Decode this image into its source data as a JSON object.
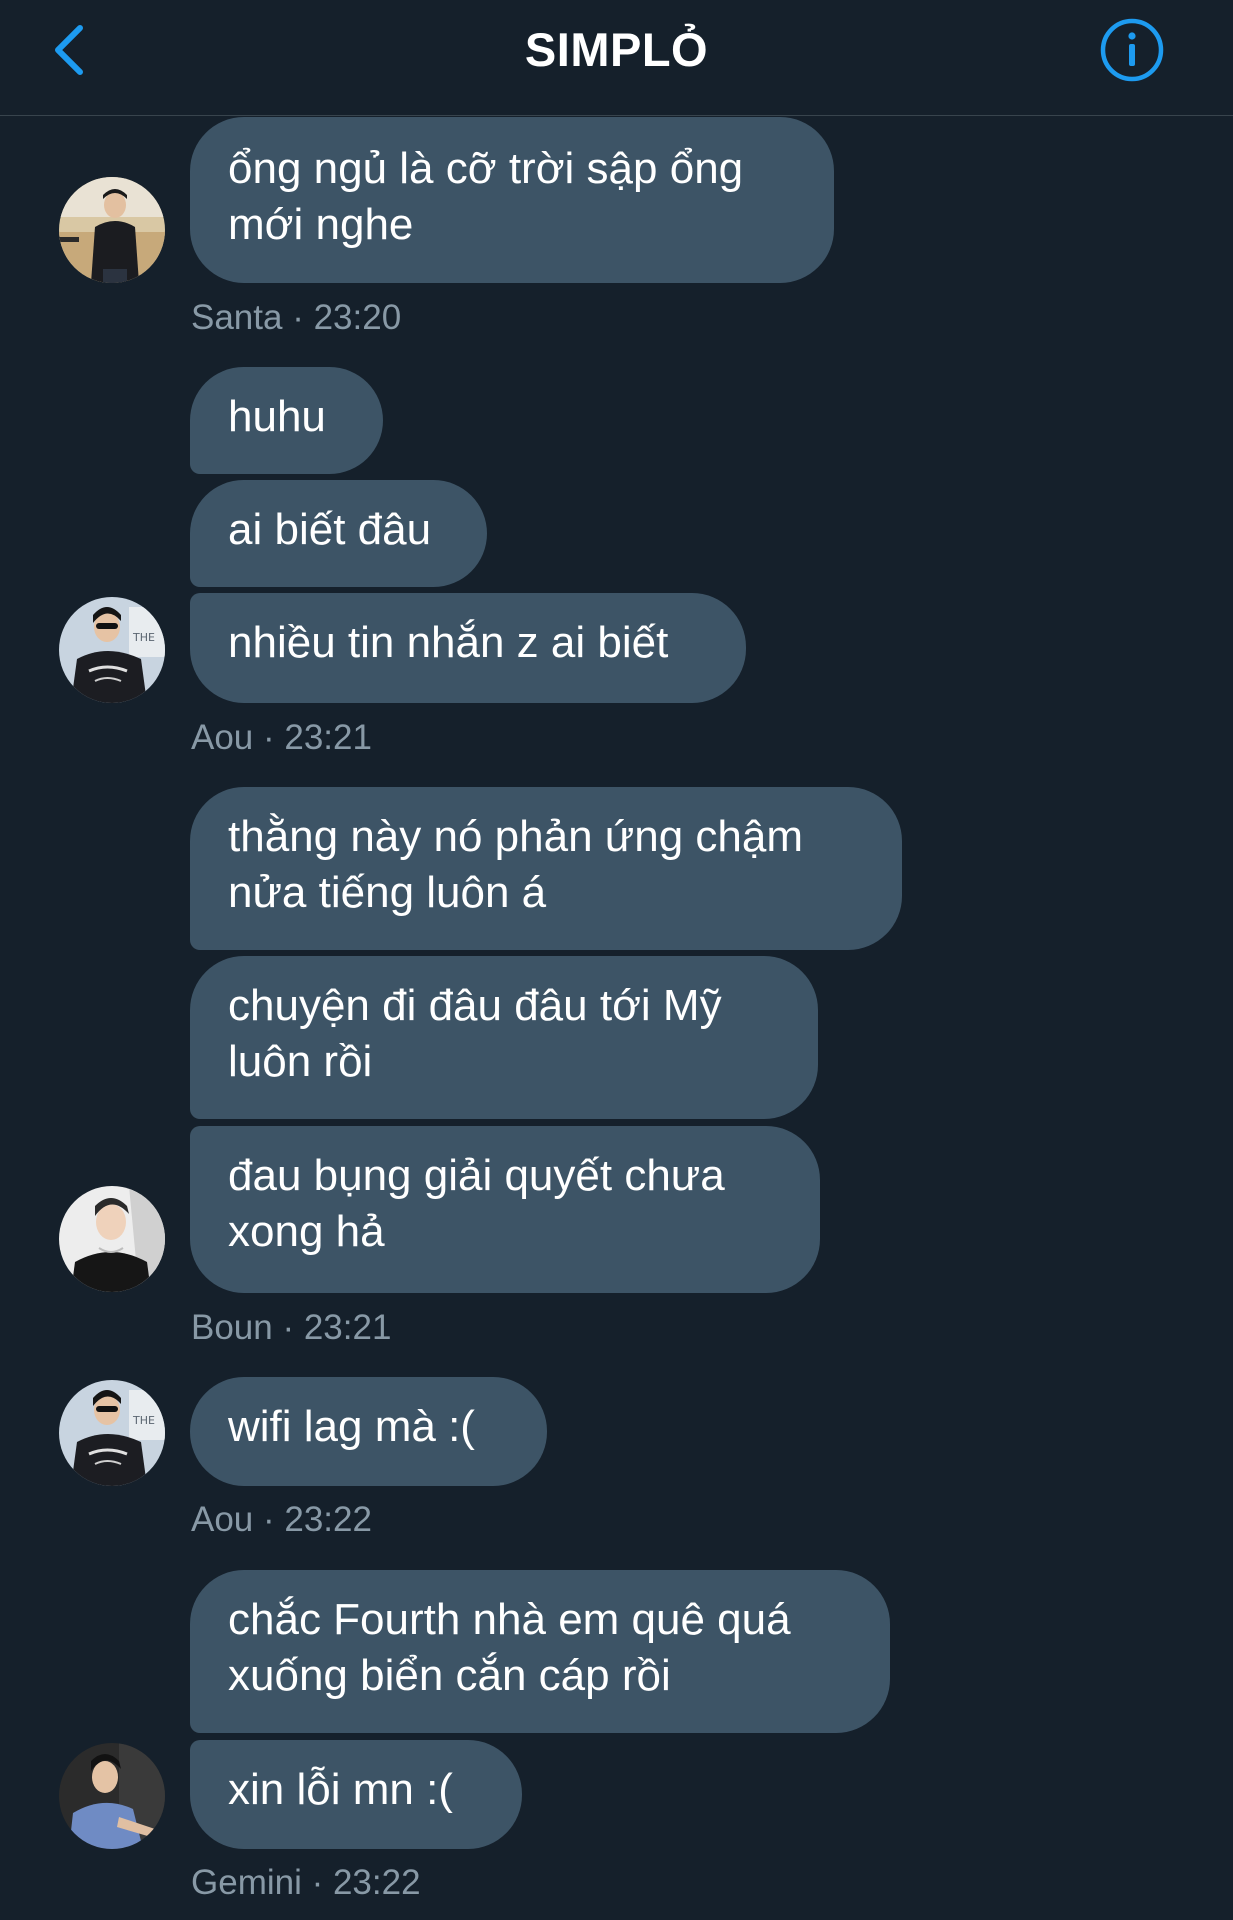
{
  "header": {
    "title": "SIMPLỎ",
    "back_icon": "chevron-left-icon",
    "info_icon": "info-circle-icon",
    "accent_color": "#1d9bf0"
  },
  "messages": [
    {
      "sender": "Santa",
      "time": "23:20",
      "meta": "Santa · 23:20",
      "bubbles": [
        "ổng ngủ là cỡ trời sập ổng\nmới nghe"
      ]
    },
    {
      "sender": "Aou",
      "time": "23:21",
      "meta": "Aou · 23:21",
      "bubbles": [
        "huhu",
        "ai biết đâu",
        "nhiều tin nhắn z ai biết"
      ]
    },
    {
      "sender": "Boun",
      "time": "23:21",
      "meta": "Boun · 23:21",
      "bubbles": [
        "thằng này nó phản ứng chậm\nnửa tiếng luôn á",
        "chuyện đi đâu đâu tới Mỹ\nluôn rồi",
        "đau bụng giải quyết chưa\nxong hả"
      ]
    },
    {
      "sender": "Aou",
      "time": "23:22",
      "meta": "Aou · 23:22",
      "bubbles": [
        "wifi lag mà :("
      ]
    },
    {
      "sender": "Gemini",
      "time": "23:22",
      "meta": "Gemini · 23:22",
      "bubbles": [
        "chắc Fourth nhà em quê quá\nxuống biển cắn cáp rồi",
        "xin lỗi mn :("
      ]
    }
  ],
  "colors": {
    "background": "#15202b",
    "bubble": "#3d5466",
    "meta_text": "#8899a6"
  }
}
